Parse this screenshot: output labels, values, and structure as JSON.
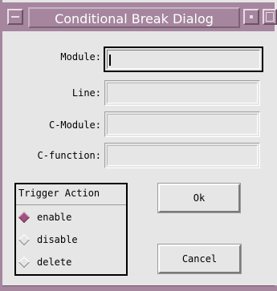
{
  "window": {
    "title": "Conditional Break Dialog"
  },
  "fields": [
    {
      "label": "Module:",
      "value": ""
    },
    {
      "label": "Line:",
      "value": ""
    },
    {
      "label": "C-Module:",
      "value": ""
    },
    {
      "label": "C-function:",
      "value": ""
    }
  ],
  "trigger": {
    "title": "Trigger Action",
    "options": [
      {
        "label": "enable",
        "selected": true
      },
      {
        "label": "disable",
        "selected": false
      },
      {
        "label": "delete",
        "selected": false
      }
    ]
  },
  "buttons": {
    "ok": "Ok",
    "cancel": "Cancel"
  },
  "colors": {
    "titlebar": "#a5869e",
    "radio_selected": "#a0517e",
    "background": "#e6e6e6"
  }
}
